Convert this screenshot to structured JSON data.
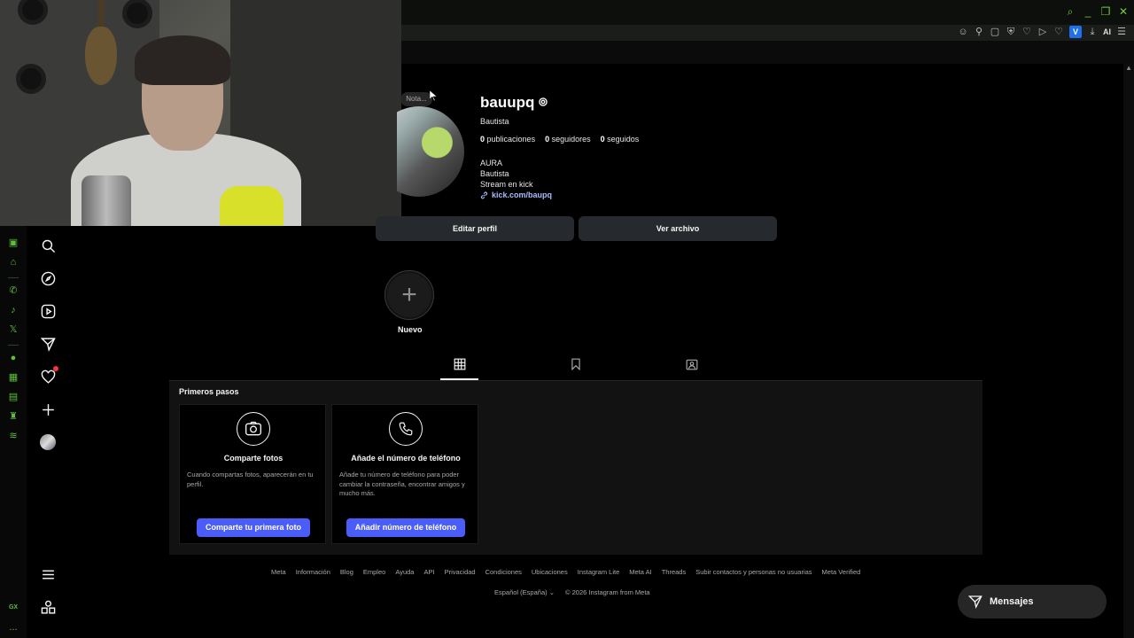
{
  "browser": {
    "ai_label": "AI",
    "v_label": "V"
  },
  "profile": {
    "nota": "Nota...",
    "username": "bauupq",
    "full_name": "Bautista",
    "stats": {
      "posts_count": "0",
      "posts_label": "publicaciones",
      "followers_count": "0",
      "followers_label": "seguidores",
      "following_count": "0",
      "following_label": "seguidos"
    },
    "bio": [
      "AURA",
      "Bautista",
      "Stream en kick"
    ],
    "link": "kick.com/baupq",
    "edit_button": "Editar perfil",
    "archive_button": "Ver archivo"
  },
  "highlight": {
    "new_label": "Nuevo"
  },
  "getting_started": {
    "title": "Primeros pasos",
    "cards": [
      {
        "title": "Comparte fotos",
        "description": "Cuando compartas fotos, aparecerán en tu perfil.",
        "button": "Comparte tu primera foto"
      },
      {
        "title": "Añade el número de teléfono",
        "description": "Añade tu número de teléfono para poder cambiar la contraseña, encontrar amigos y mucho más.",
        "button": "Añadir número de teléfono"
      }
    ]
  },
  "footer": {
    "links": [
      "Meta",
      "Información",
      "Blog",
      "Empleo",
      "Ayuda",
      "API",
      "Privacidad",
      "Condiciones",
      "Ubicaciones",
      "Instagram Lite",
      "Meta AI",
      "Threads",
      "Subir contactos y personas no usuarias",
      "Meta Verified"
    ],
    "language": "Español (España)",
    "copyright": "© 2026 Instagram from Meta"
  },
  "messages": {
    "label": "Mensajes"
  },
  "opera": {
    "gx_label": "GX",
    "more_label": "..."
  },
  "colors": {
    "accent_blue": "#4a5df9",
    "opera_green": "#5fbf3c",
    "notification_red": "#ff3040",
    "link_blue": "#a8bcff"
  }
}
